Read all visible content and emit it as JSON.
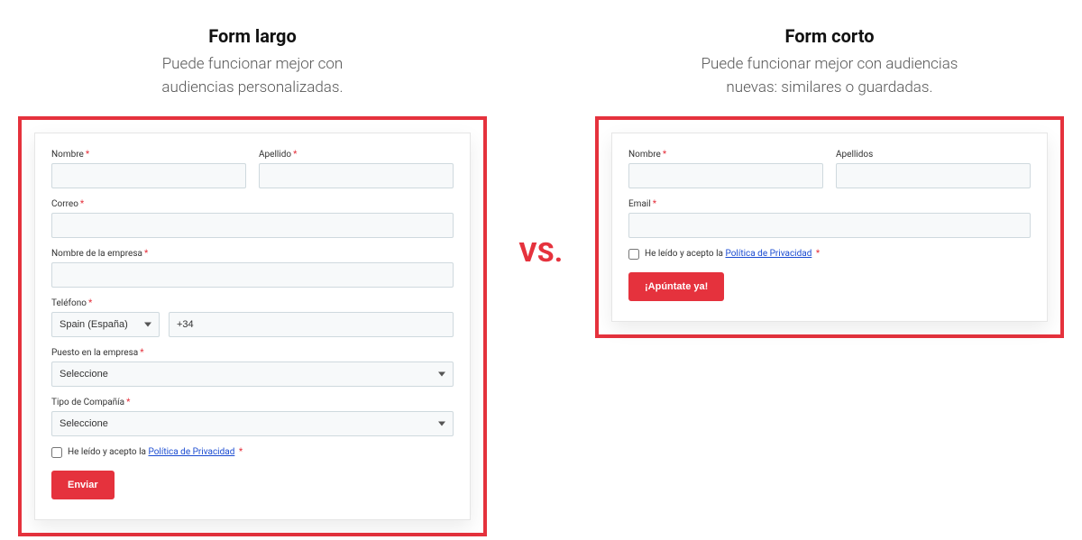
{
  "vs_label": "VS.",
  "accent_color": "#E5323D",
  "left": {
    "title": "Form largo",
    "subtitle_line1": "Puede funcionar mejor con",
    "subtitle_line2": "audiencias personalizadas.",
    "fields": {
      "nombre_label": "Nombre",
      "apellido_label": "Apellido",
      "correo_label": "Correo",
      "empresa_label": "Nombre de la empresa",
      "telefono_label": "Teléfono",
      "telefono_country": "Spain (España)",
      "telefono_prefix": "+34",
      "puesto_label": "Puesto en la empresa",
      "puesto_placeholder": "Seleccione",
      "tipo_label": "Tipo de Compañía",
      "tipo_placeholder": "Seleccione"
    },
    "consent": {
      "pre": "He leído y acepto la ",
      "link": "Política de Privacidad"
    },
    "submit": "Enviar"
  },
  "right": {
    "title": "Form corto",
    "subtitle_line1": "Puede funcionar mejor con audiencias",
    "subtitle_line2": "nuevas: similares o guardadas.",
    "fields": {
      "nombre_label": "Nombre",
      "apellidos_label": "Apellidos",
      "email_label": "Email"
    },
    "consent": {
      "pre": "He leído y acepto la ",
      "link": "Política de Privacidad"
    },
    "submit": "¡Apúntate ya!"
  }
}
